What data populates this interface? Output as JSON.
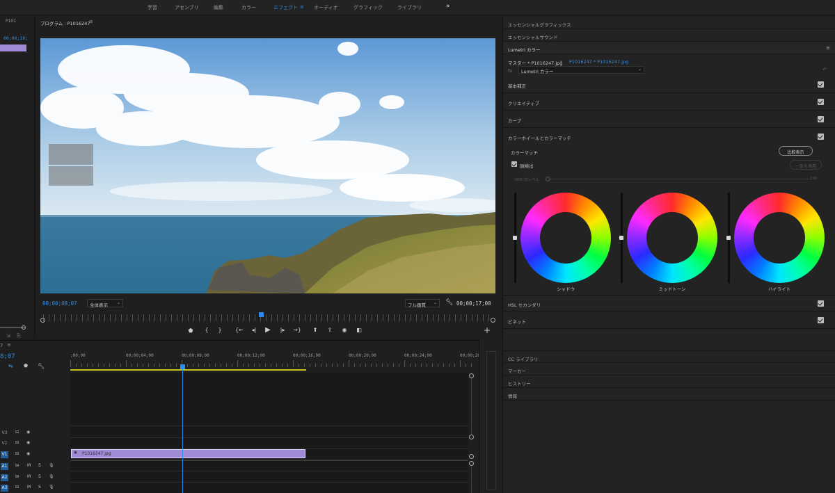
{
  "workspace_tabs": [
    "学習",
    "アセンブリ",
    "編集",
    "カラー",
    "エフェクト",
    "オーディオ",
    "グラフィック",
    "ライブラリ"
  ],
  "workspace_active": "エフェクト",
  "workspace_more": "»",
  "left_strip": {
    "title": "P101",
    "timecode": "00;00;16;"
  },
  "program": {
    "title": "プログラム : P1016247",
    "menu_icon": "≡",
    "timecode_current": "00;00;08;07",
    "zoom_select": "全体表示",
    "quality_select": "フル画質",
    "timecode_duration": "00;00;17;00",
    "playhead_fraction": 0.48
  },
  "timeline": {
    "timecode": "8;07",
    "ruler_ticks": [
      ";00;00",
      "00;00;04;00",
      "00;00;08;00",
      "00;00;12;00",
      "00;00;16;00",
      "00;00;20;00",
      "00;00;24;00",
      "00;00;28;0"
    ],
    "tracks": [
      {
        "name": "V3",
        "active": false,
        "type": "video"
      },
      {
        "name": "V2",
        "active": false,
        "type": "video"
      },
      {
        "name": "V1",
        "active": true,
        "type": "video"
      },
      {
        "name": "A1",
        "active": true,
        "type": "audio"
      },
      {
        "name": "A2",
        "active": true,
        "type": "audio"
      },
      {
        "name": "A3",
        "active": true,
        "type": "audio"
      }
    ],
    "clip_name": "P1016247.jpg",
    "clip_color": "#a08ad6"
  },
  "right_panel": {
    "essential_graphics": "エッセンシャルグラフィックス",
    "essential_sound": "エッセンシャルサウンド",
    "lumetri_title": "Lumetri カラー",
    "master_label": "マスター * P1016247.jpg",
    "clip_label": "P1016247 * P1016247.jpg",
    "fx_select": "Lumetri カラー",
    "sections": [
      "基本補正",
      "クリエイティブ",
      "カーブ",
      "カラーホイールとカラーマッチ"
    ],
    "color_match": "カラーマッチ",
    "compare_button": "比較表示",
    "face_detect": "顔検出",
    "apply_match": "一致を適用",
    "hdr_white": "HDR 白レベル",
    "hdr_value": "100",
    "wheels": [
      "シャドウ",
      "ミッドトーン",
      "ハイライト"
    ],
    "hsl": "HSL セカンダリ",
    "vignette": "ビネット",
    "bottom_panels": [
      "CC ライブラリ",
      "マーカー",
      "ヒストリー",
      "情報"
    ]
  },
  "colors": {
    "accent": "#2d8ceb",
    "panel": "#232323",
    "clip": "#a08ad6"
  }
}
